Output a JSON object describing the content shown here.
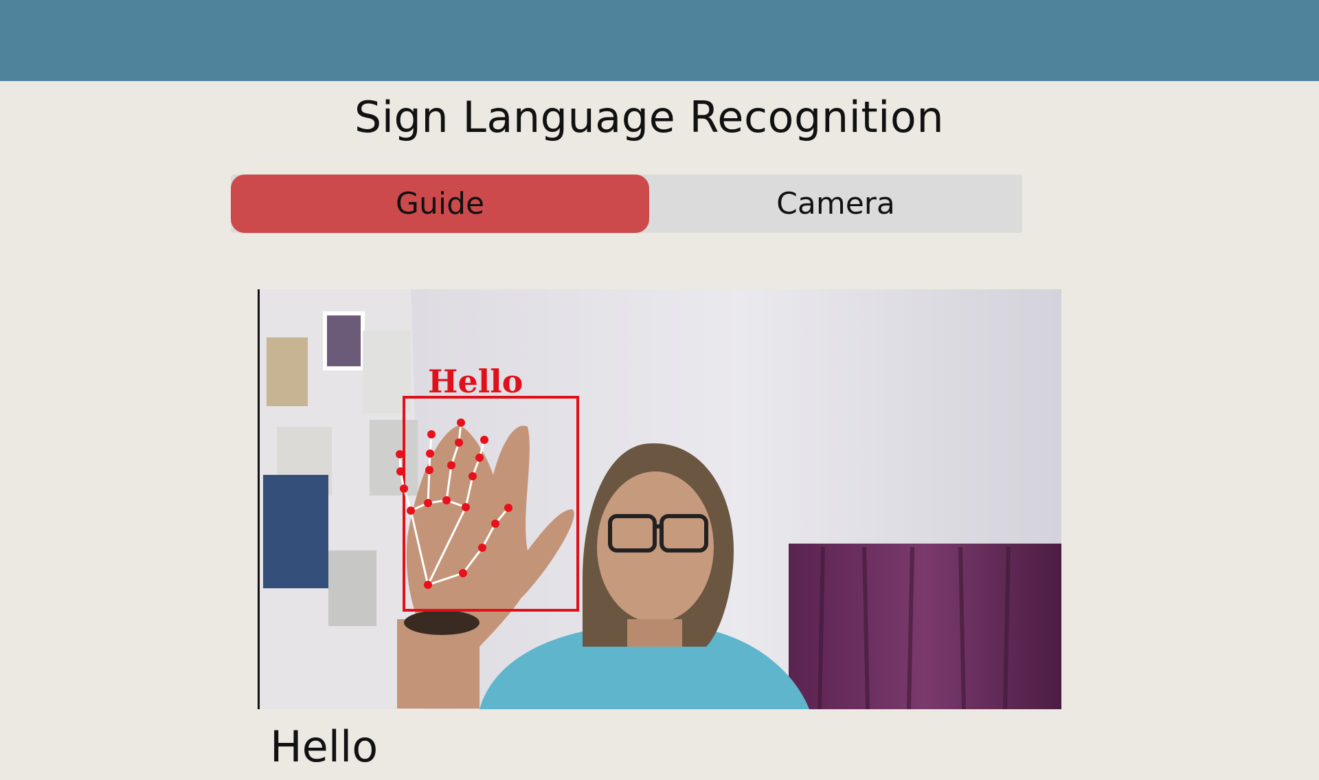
{
  "app": {
    "title": "Sign Language Recognition"
  },
  "tabs": [
    {
      "label": "Guide",
      "active": true
    },
    {
      "label": "Camera",
      "active": false
    }
  ],
  "camera_feed": {
    "detected_label": "Hello"
  },
  "result": {
    "text": "Hello"
  },
  "colors": {
    "header": "#4f839c",
    "background": "#ebe9e2",
    "active_tab": "#cc4a4b",
    "inactive_tab": "#dcdbdb",
    "detection": "#e0101a"
  }
}
